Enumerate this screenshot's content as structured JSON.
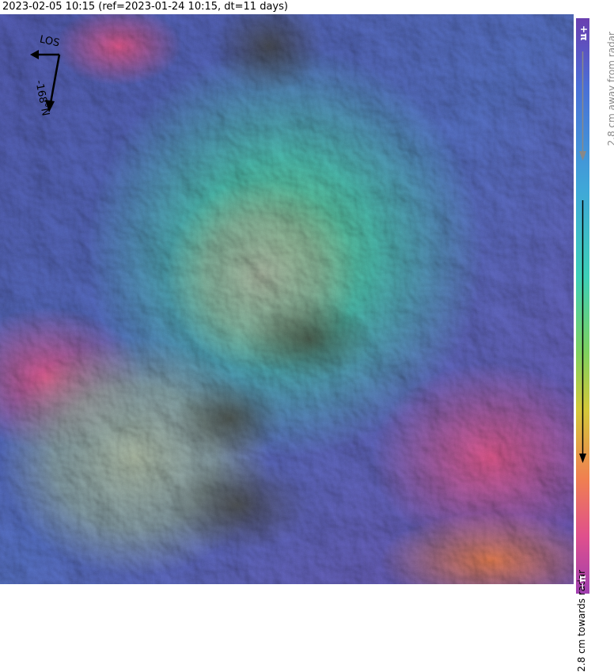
{
  "header": {
    "title": "2023-02-05 10:15 (ref=2023-01-24 10:15, dt=11 days)"
  },
  "map": {
    "los_label": "LOS",
    "heading_label": "-168°N",
    "icons": [
      "los-arrow-icon",
      "heading-arrow-icon"
    ]
  },
  "colorbar": {
    "top_tick": "+π",
    "bottom_tick": "−π",
    "away_label": "2.8 cm away from radar",
    "towards_label": "2.8 cm towards radar",
    "colors": [
      "#6a3fb0",
      "#4a6fd6",
      "#3fa8d8",
      "#3dd0b8",
      "#7ed160",
      "#d4c83a",
      "#f08050",
      "#e0508c",
      "#a03fb0"
    ]
  }
}
